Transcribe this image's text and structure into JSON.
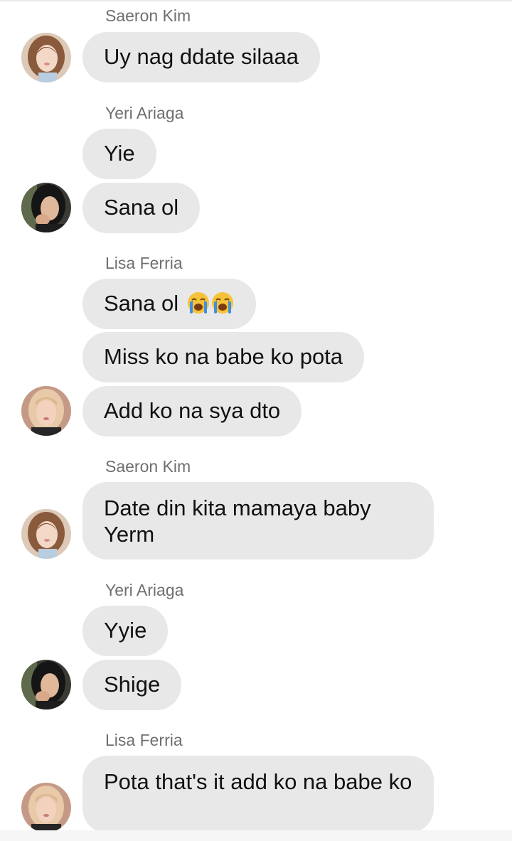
{
  "colors": {
    "bubble": "#e8e8e8",
    "name_text": "#6f6f6f",
    "message_text": "#111111"
  },
  "groups": [
    {
      "sender": "Saeron Kim",
      "avatar": "avatar-saeron-kim",
      "messages": [
        "Uy nag ddate silaaa"
      ]
    },
    {
      "sender": "Yeri Ariaga",
      "avatar": "avatar-yeri-ariaga",
      "messages": [
        "Yie",
        "Sana ol"
      ]
    },
    {
      "sender": "Lisa Ferria",
      "avatar": "avatar-lisa-ferria",
      "messages": [
        {
          "text": "Sana ol",
          "emoji": [
            "loudly-crying-face-icon",
            "loudly-crying-face-icon"
          ]
        },
        "Miss ko na babe ko pota",
        "Add ko na sya dto"
      ]
    },
    {
      "sender": "Saeron Kim",
      "avatar": "avatar-saeron-kim",
      "messages": [
        "Date din kita mamaya baby Yerm"
      ]
    },
    {
      "sender": "Yeri Ariaga",
      "avatar": "avatar-yeri-ariaga",
      "messages": [
        "Yyie",
        "Shige"
      ]
    },
    {
      "sender": "Lisa Ferria",
      "avatar": "avatar-lisa-ferria",
      "messages": [
        "Pota that's it add ko na babe ko"
      ]
    }
  ]
}
